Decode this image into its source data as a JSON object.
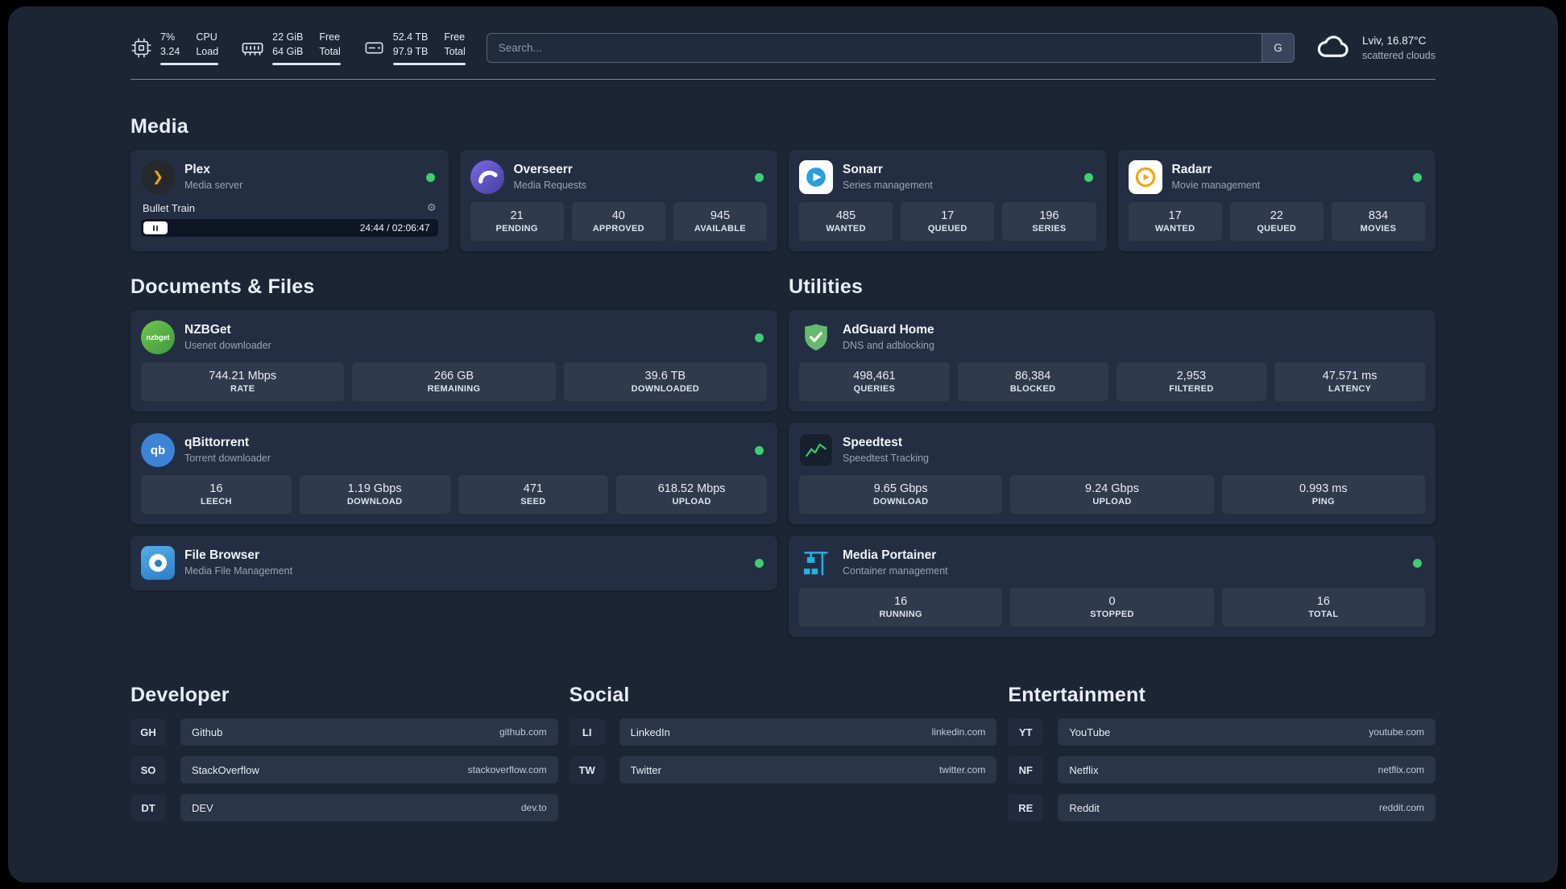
{
  "header": {
    "cpu": {
      "line1": "7%",
      "line2": "3.24",
      "cap1": "CPU",
      "cap2": "Load"
    },
    "mem": {
      "line1": "22 GiB",
      "line2": "64 GiB",
      "cap1": "Free",
      "cap2": "Total"
    },
    "disk": {
      "line1": "52.4 TB",
      "line2": "97.9 TB",
      "cap1": "Free",
      "cap2": "Total"
    },
    "search_placeholder": "Search...",
    "search_button": "G",
    "weather_location": "Lviv, 16.87°C",
    "weather_condition": "scattered clouds"
  },
  "section_titles": {
    "media": "Media",
    "documents": "Documents & Files",
    "utilities": "Utilities",
    "developer": "Developer",
    "social": "Social",
    "entertainment": "Entertainment"
  },
  "media": {
    "plex": {
      "title": "Plex",
      "subtitle": "Media server",
      "now_playing": "Bullet Train",
      "time": "24:44 / 02:06:47"
    },
    "overseerr": {
      "title": "Overseerr",
      "subtitle": "Media Requests",
      "stats": [
        {
          "value": "21",
          "label": "PENDING"
        },
        {
          "value": "40",
          "label": "APPROVED"
        },
        {
          "value": "945",
          "label": "AVAILABLE"
        }
      ]
    },
    "sonarr": {
      "title": "Sonarr",
      "subtitle": "Series management",
      "stats": [
        {
          "value": "485",
          "label": "WANTED"
        },
        {
          "value": "17",
          "label": "QUEUED"
        },
        {
          "value": "196",
          "label": "SERIES"
        }
      ]
    },
    "radarr": {
      "title": "Radarr",
      "subtitle": "Movie management",
      "stats": [
        {
          "value": "17",
          "label": "WANTED"
        },
        {
          "value": "22",
          "label": "QUEUED"
        },
        {
          "value": "834",
          "label": "MOVIES"
        }
      ]
    }
  },
  "documents": {
    "nzbget": {
      "title": "NZBGet",
      "subtitle": "Usenet downloader",
      "stats": [
        {
          "value": "744.21 Mbps",
          "label": "RATE"
        },
        {
          "value": "266 GB",
          "label": "REMAINING"
        },
        {
          "value": "39.6 TB",
          "label": "DOWNLOADED"
        }
      ]
    },
    "qbittorrent": {
      "title": "qBittorrent",
      "subtitle": "Torrent downloader",
      "stats": [
        {
          "value": "16",
          "label": "LEECH"
        },
        {
          "value": "1.19 Gbps",
          "label": "DOWNLOAD"
        },
        {
          "value": "471",
          "label": "SEED"
        },
        {
          "value": "618.52 Mbps",
          "label": "UPLOAD"
        }
      ]
    },
    "filebrowser": {
      "title": "File Browser",
      "subtitle": "Media File Management"
    }
  },
  "utilities": {
    "adguard": {
      "title": "AdGuard Home",
      "subtitle": "DNS and adblocking",
      "stats": [
        {
          "value": "498,461",
          "label": "QUERIES"
        },
        {
          "value": "86,384",
          "label": "BLOCKED"
        },
        {
          "value": "2,953",
          "label": "FILTERED"
        },
        {
          "value": "47.571 ms",
          "label": "LATENCY"
        }
      ]
    },
    "speedtest": {
      "title": "Speedtest",
      "subtitle": "Speedtest Tracking",
      "stats": [
        {
          "value": "9.65 Gbps",
          "label": "DOWNLOAD"
        },
        {
          "value": "9.24 Gbps",
          "label": "UPLOAD"
        },
        {
          "value": "0.993 ms",
          "label": "PING"
        }
      ]
    },
    "portainer": {
      "title": "Media Portainer",
      "subtitle": "Container management",
      "stats": [
        {
          "value": "16",
          "label": "RUNNING"
        },
        {
          "value": "0",
          "label": "STOPPED"
        },
        {
          "value": "16",
          "label": "TOTAL"
        }
      ]
    }
  },
  "bookmarks": {
    "developer": [
      {
        "abbr": "GH",
        "name": "Github",
        "url": "github.com"
      },
      {
        "abbr": "SO",
        "name": "StackOverflow",
        "url": "stackoverflow.com"
      },
      {
        "abbr": "DT",
        "name": "DEV",
        "url": "dev.to"
      }
    ],
    "social": [
      {
        "abbr": "LI",
        "name": "LinkedIn",
        "url": "linkedin.com"
      },
      {
        "abbr": "TW",
        "name": "Twitter",
        "url": "twitter.com"
      }
    ],
    "entertainment": [
      {
        "abbr": "YT",
        "name": "YouTube",
        "url": "youtube.com"
      },
      {
        "abbr": "NF",
        "name": "Netflix",
        "url": "netflix.com"
      },
      {
        "abbr": "RE",
        "name": "Reddit",
        "url": "reddit.com"
      }
    ]
  },
  "icons": {
    "plex_glyph": "❯",
    "gear_glyph": "⚙",
    "nzbget_label": "nzbget",
    "qbittorrent_label": "qb"
  },
  "colors": {
    "background": "#1c2534",
    "card": "#242e42",
    "status_online": "#3ecf6e",
    "accent_plex": "#e6a817",
    "accent_overseerr": "#6657d4",
    "accent_sonarr": "#35a8e0",
    "accent_radarr": "#f3a712",
    "accent_nzbget": "#5cb344",
    "accent_qbittorrent": "#3d84d6",
    "accent_filebrowser": "#3d9de0",
    "accent_adguard": "#67b96f",
    "accent_speedtest": "#2fd26b",
    "accent_portainer": "#1fb3e8"
  }
}
